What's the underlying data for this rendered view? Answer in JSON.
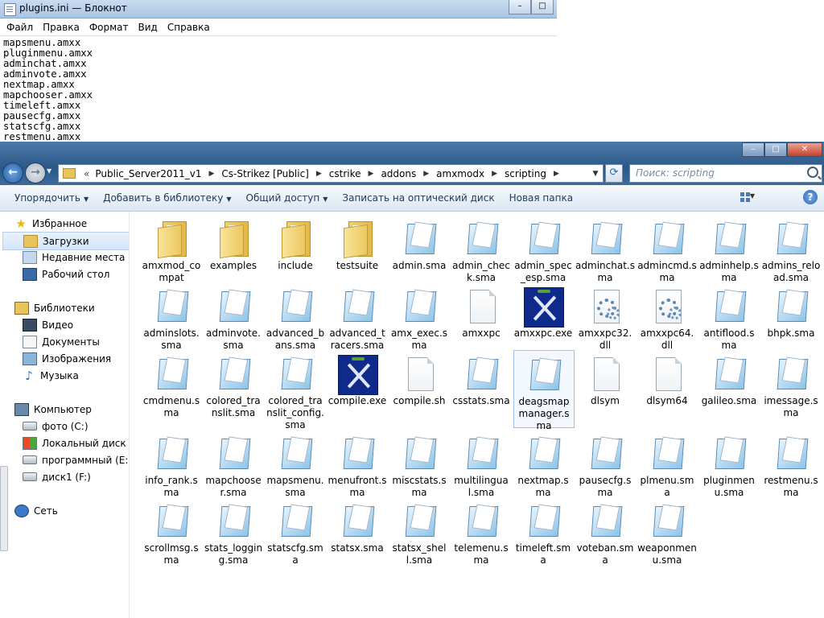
{
  "notepad": {
    "title": "plugins.ini — Блокнот",
    "menu": [
      "Файл",
      "Правка",
      "Формат",
      "Вид",
      "Справка"
    ],
    "lines": [
      "mapsmenu.amxx",
      "pluginmenu.amxx",
      "adminchat.amxx",
      "adminvote.amxx",
      "nextmap.amxx",
      "mapchooser.amxx",
      "timeleft.amxx",
      "pausecfg.amxx",
      "statscfg.amxx",
      "restmenu.amxx"
    ]
  },
  "explorer": {
    "breadcrumb_prefix": "«",
    "breadcrumb": [
      "Public_Server2011_v1",
      "Cs-Strikez [Public]",
      "cstrike",
      "addons",
      "amxmodx",
      "scripting"
    ],
    "search_placeholder": "Поиск: scripting",
    "toolbar": {
      "organize": "Упорядочить",
      "add_to_library": "Добавить в библиотеку",
      "share": "Общий доступ",
      "burn": "Записать на оптический диск",
      "new_folder": "Новая папка"
    },
    "nav": [
      {
        "label": "Избранное",
        "icon": "star"
      },
      {
        "label": "Загрузки",
        "icon": "folder"
      },
      {
        "label": "Недавние места",
        "icon": "recent"
      },
      {
        "label": "Рабочий стол",
        "icon": "desktop"
      },
      {
        "label": "Библиотеки",
        "icon": "libs"
      },
      {
        "label": "Видео",
        "icon": "video"
      },
      {
        "label": "Документы",
        "icon": "docs"
      },
      {
        "label": "Изображения",
        "icon": "images"
      },
      {
        "label": "Музыка",
        "icon": "music"
      },
      {
        "label": "Компьютер",
        "icon": "comp"
      },
      {
        "label": "фото (C:)",
        "icon": "drive"
      },
      {
        "label": "Локальный диск (D",
        "icon": "win"
      },
      {
        "label": "программный (E:)",
        "icon": "drive"
      },
      {
        "label": "диск1 (F:)",
        "icon": "drive"
      },
      {
        "label": "Сеть",
        "icon": "net"
      }
    ],
    "files": [
      {
        "name": "amxmod_compat",
        "type": "folder"
      },
      {
        "name": "examples",
        "type": "folder"
      },
      {
        "name": "include",
        "type": "folder"
      },
      {
        "name": "testsuite",
        "type": "folder"
      },
      {
        "name": "admin.sma",
        "type": "sma"
      },
      {
        "name": "admin_check.sma",
        "type": "sma"
      },
      {
        "name": "admin_spec_esp.sma",
        "type": "sma"
      },
      {
        "name": "adminchat.sma",
        "type": "sma"
      },
      {
        "name": "admincmd.sma",
        "type": "sma"
      },
      {
        "name": "adminhelp.sma",
        "type": "sma"
      },
      {
        "name": "admins_reload.sma",
        "type": "sma"
      },
      {
        "name": "adminslots.sma",
        "type": "sma"
      },
      {
        "name": "adminvote.sma",
        "type": "sma"
      },
      {
        "name": "advanced_bans.sma",
        "type": "sma"
      },
      {
        "name": "advanced_tracers.sma",
        "type": "sma"
      },
      {
        "name": "amx_exec.sma",
        "type": "sma"
      },
      {
        "name": "amxxpc",
        "type": "blank"
      },
      {
        "name": "amxxpc.exe",
        "type": "exe"
      },
      {
        "name": "amxxpc32.dll",
        "type": "dll"
      },
      {
        "name": "amxxpc64.dll",
        "type": "dll"
      },
      {
        "name": "antiflood.sma",
        "type": "sma"
      },
      {
        "name": "bhpk.sma",
        "type": "sma"
      },
      {
        "name": "cmdmenu.sma",
        "type": "sma"
      },
      {
        "name": "colored_translit.sma",
        "type": "sma"
      },
      {
        "name": "colored_translit_config.sma",
        "type": "sma"
      },
      {
        "name": "compile.exe",
        "type": "exe"
      },
      {
        "name": "compile.sh",
        "type": "blank"
      },
      {
        "name": "csstats.sma",
        "type": "sma"
      },
      {
        "name": "deagsmapmanager.sma",
        "type": "sma"
      },
      {
        "name": "dlsym",
        "type": "blank"
      },
      {
        "name": "dlsym64",
        "type": "blank"
      },
      {
        "name": "galileo.sma",
        "type": "sma"
      },
      {
        "name": "imessage.sma",
        "type": "sma"
      },
      {
        "name": "info_rank.sma",
        "type": "sma"
      },
      {
        "name": "mapchooser.sma",
        "type": "sma"
      },
      {
        "name": "mapsmenu.sma",
        "type": "sma"
      },
      {
        "name": "menufront.sma",
        "type": "sma"
      },
      {
        "name": "miscstats.sma",
        "type": "sma"
      },
      {
        "name": "multilingual.sma",
        "type": "sma"
      },
      {
        "name": "nextmap.sma",
        "type": "sma"
      },
      {
        "name": "pausecfg.sma",
        "type": "sma"
      },
      {
        "name": "plmenu.sma",
        "type": "sma"
      },
      {
        "name": "pluginmenu.sma",
        "type": "sma"
      },
      {
        "name": "restmenu.sma",
        "type": "sma"
      },
      {
        "name": "scrollmsg.sma",
        "type": "sma"
      },
      {
        "name": "stats_logging.sma",
        "type": "sma"
      },
      {
        "name": "statscfg.sma",
        "type": "sma"
      },
      {
        "name": "statsx.sma",
        "type": "sma"
      },
      {
        "name": "statsx_shell.sma",
        "type": "sma"
      },
      {
        "name": "telemenu.sma",
        "type": "sma"
      },
      {
        "name": "timeleft.sma",
        "type": "sma"
      },
      {
        "name": "voteban.sma",
        "type": "sma"
      },
      {
        "name": "weaponmenu.sma",
        "type": "sma"
      }
    ],
    "selected_file": "deagsmapmanager.sma"
  }
}
